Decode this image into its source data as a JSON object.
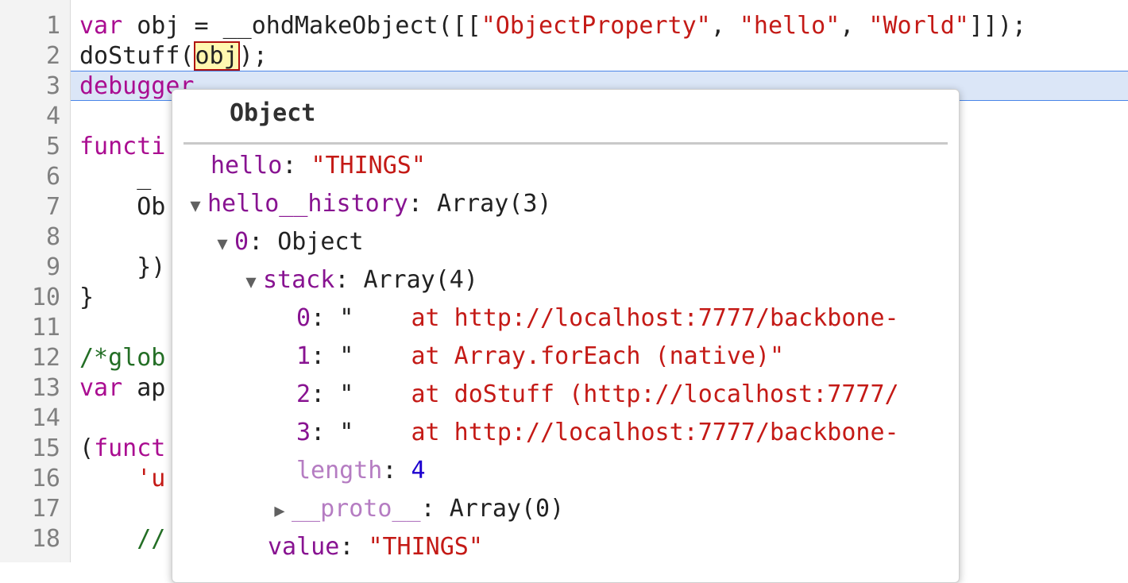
{
  "editor": {
    "line_numbers": [
      "1",
      "2",
      "3",
      "4",
      "5",
      "6",
      "7",
      "8",
      "9",
      "10",
      "11",
      "12",
      "13",
      "14",
      "15",
      "16",
      "17",
      "18"
    ],
    "lines": {
      "l1": {
        "kw": "var",
        "rest1": " obj = __ohdMakeObject([[",
        "s1": "\"ObjectProperty\"",
        "c1": ", ",
        "s2": "\"hello\"",
        "c2": ", ",
        "s3": "\"World\"",
        "end": "]]);"
      },
      "l2": {
        "pre": "doStuff(",
        "hl": "obj",
        "post": ");"
      },
      "l3": {
        "kw": "debugger"
      },
      "l5": {
        "kw": "functi"
      },
      "l6": {
        "text": "    _"
      },
      "l7": {
        "text": "    Ob"
      },
      "l9": {
        "text": "    })"
      },
      "l10": {
        "text": "}"
      },
      "l12": {
        "cm": "/*glob"
      },
      "l13": {
        "kw": "var",
        "rest": " ap"
      },
      "l15": {
        "pre": "(",
        "kw": "funct"
      },
      "l16": {
        "pre": "    ",
        "str": "'u"
      },
      "l18": {
        "cm": "    //"
      }
    }
  },
  "popover": {
    "title": "Object",
    "rows": {
      "r1": {
        "key": "hello",
        "sep": ": ",
        "val": "\"THINGS\""
      },
      "r2": {
        "key": "hello__history",
        "sep": ": ",
        "val": "Array(3)"
      },
      "r3": {
        "key": "0",
        "sep": ": ",
        "val": "Object"
      },
      "r4": {
        "key": "stack",
        "sep": ": ",
        "val": "Array(4)"
      },
      "r5": {
        "key": "0",
        "sep": ": ",
        "q": "\"",
        "val": "    at http://localhost:7777/backbone-"
      },
      "r6": {
        "key": "1",
        "sep": ": ",
        "q": "\"",
        "val": "    at Array.forEach (native)\""
      },
      "r7": {
        "key": "2",
        "sep": ": ",
        "q": "\"",
        "val": "    at doStuff (http://localhost:7777/"
      },
      "r8": {
        "key": "3",
        "sep": ": ",
        "q": "\"",
        "val": "    at http://localhost:7777/backbone-"
      },
      "r9": {
        "key": "length",
        "sep": ": ",
        "val": "4"
      },
      "r10": {
        "key": "__proto__",
        "sep": ": ",
        "val": "Array(0)"
      },
      "r11": {
        "key": "value",
        "sep": ": ",
        "val": "\"THINGS\""
      }
    },
    "icons": {
      "expanded": "triangle-down-icon",
      "collapsed": "triangle-right-icon"
    }
  }
}
